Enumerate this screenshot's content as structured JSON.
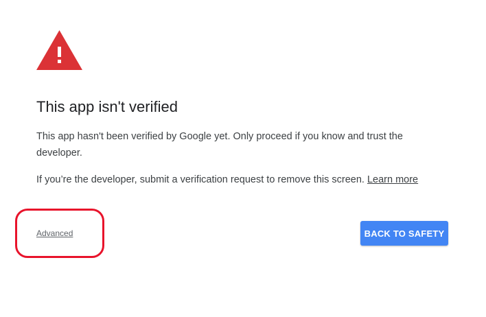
{
  "page": {
    "title": "This app isn't verified",
    "paragraph1": "This app hasn't been verified by Google yet. Only proceed if you know and trust the developer.",
    "paragraph2_text": "If you’re the developer, submit a verification request to remove this screen.",
    "learn_more_label": "Learn more",
    "advanced_label": "Advanced",
    "back_to_safety_label": "BACK TO SAFETY"
  },
  "icons": {
    "warning": "warning-triangle-icon"
  },
  "colors": {
    "warning_red": "#db3236",
    "button_blue": "#4285f4",
    "highlight_red": "#e8132b"
  }
}
